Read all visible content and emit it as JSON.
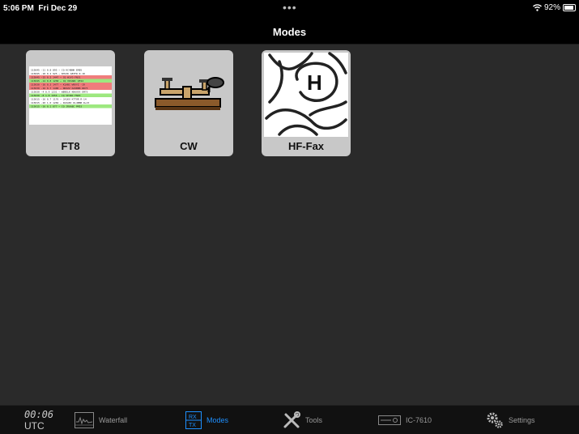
{
  "status": {
    "time": "5:06 PM",
    "date": "Fri Dec 29",
    "dots": "•••",
    "battery": "92%"
  },
  "nav": {
    "title": "Modes"
  },
  "modes": [
    {
      "label": "FT8",
      "icon": "ft8-decode-list-icon"
    },
    {
      "label": "CW",
      "icon": "morse-key-icon"
    },
    {
      "label": "HF-Fax",
      "icon": "weather-map-icon"
    }
  ],
  "tabbar": {
    "clock": {
      "time": "00:06",
      "zone": "UTC"
    },
    "tabs": [
      {
        "label": "Waterfall",
        "icon": "waterfall-icon",
        "active": false
      },
      {
        "label": "Modes",
        "icon": "rx-tx-icon",
        "active": true
      },
      {
        "label": "Tools",
        "icon": "tools-icon",
        "active": false
      },
      {
        "label": "IC-7610",
        "icon": "radio-icon",
        "active": false
      },
      {
        "label": "Settings",
        "icon": "gears-icon",
        "active": false
      }
    ],
    "active_color": "#1e90ff"
  }
}
